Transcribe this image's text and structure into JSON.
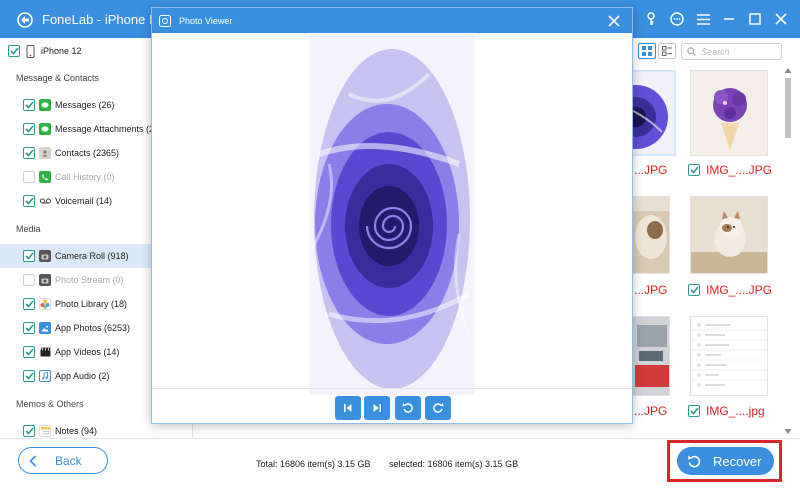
{
  "app": {
    "title": "FoneLab - iPhone Da"
  },
  "device": {
    "name": "iPhone 12"
  },
  "sidebar": {
    "sections": [
      {
        "label": "Message & Contacts"
      },
      {
        "label": "Media"
      },
      {
        "label": "Memos & Others"
      }
    ],
    "items": [
      {
        "label": "Messages (26)",
        "checked": true,
        "icon": "message-icon",
        "color": "#2fb344"
      },
      {
        "label": "Message Attachments (2",
        "checked": true,
        "icon": "message-attachment-icon",
        "color": "#2fb344"
      },
      {
        "label": "Contacts (2365)",
        "checked": true,
        "icon": "contacts-icon",
        "color": "#8a8a8a"
      },
      {
        "label": "Call History (0)",
        "checked": false,
        "icon": "phone-icon",
        "color": "#2fb344"
      },
      {
        "label": "Voicemail (14)",
        "checked": true,
        "icon": "voicemail-icon",
        "color": "#444444"
      },
      {
        "label": "Camera Roll (918)",
        "checked": true,
        "icon": "camera-icon",
        "color": "#555555",
        "active": true
      },
      {
        "label": "Photo Stream (0)",
        "checked": false,
        "icon": "photo-stream-icon",
        "color": "#555555"
      },
      {
        "label": "Photo Library (18)",
        "checked": true,
        "icon": "photo-library-icon",
        "color": "#e8a42c"
      },
      {
        "label": "App Photos (6253)",
        "checked": true,
        "icon": "app-photos-icon",
        "color": "#3a8fe0"
      },
      {
        "label": "App Videos (14)",
        "checked": true,
        "icon": "clapperboard-icon",
        "color": "#222222"
      },
      {
        "label": "App Audio (2)",
        "checked": true,
        "icon": "music-note-icon",
        "color": "#3a8fe0"
      },
      {
        "label": "Notes (94)",
        "checked": true,
        "icon": "notes-icon",
        "color": "#f2c94c"
      }
    ]
  },
  "toolbar": {
    "search_placeholder": "Search"
  },
  "grid": {
    "captions": [
      {
        "name": "...JPG",
        "checked": false
      },
      {
        "name": "IMG_....JPG",
        "checked": true
      },
      {
        "name": "...JPG",
        "checked": false
      },
      {
        "name": "IMG_....JPG",
        "checked": true
      },
      {
        "name": "...JPG",
        "checked": false
      },
      {
        "name": "IMG_....jpg",
        "checked": true
      }
    ]
  },
  "viewer": {
    "title": "Photo Viewer"
  },
  "footer": {
    "back_label": "Back",
    "total_text": "Total: 16806 item(s) 3.15 GB",
    "selected_text": "selected: 16806 item(s) 3.15 GB",
    "recover_label": "Recover"
  },
  "colors": {
    "accent": "#3a8fe0",
    "check": "#2a9a8e",
    "filename": "#e02020",
    "highlight": "#d9262b"
  }
}
